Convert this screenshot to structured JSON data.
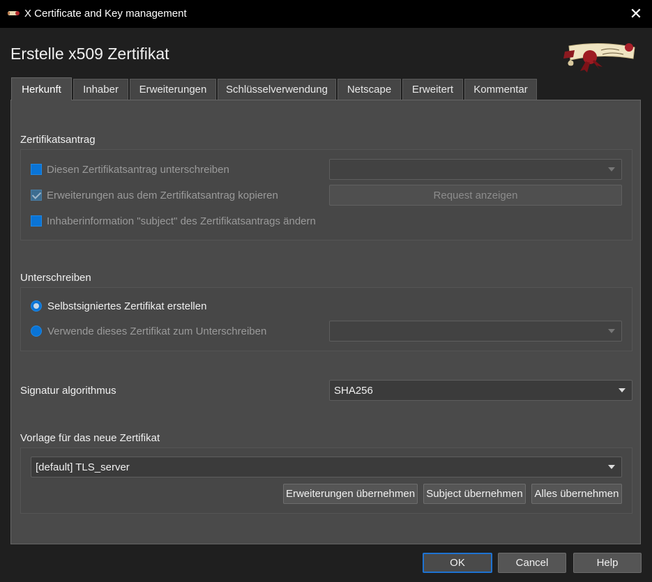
{
  "window": {
    "title": "X Certificate and Key management",
    "close_glyph": "✕"
  },
  "dialog": {
    "heading": "Erstelle x509 Zertifikat"
  },
  "tabs": [
    {
      "label": "Herkunft",
      "active": true
    },
    {
      "label": "Inhaber",
      "active": false
    },
    {
      "label": "Erweiterungen",
      "active": false
    },
    {
      "label": "Schlüsselverwendung",
      "active": false
    },
    {
      "label": "Netscape",
      "active": false
    },
    {
      "label": "Erweitert",
      "active": false
    },
    {
      "label": "Kommentar",
      "active": false
    }
  ],
  "request_section": {
    "label": "Zertifikatsantrag",
    "sign_request": {
      "label": "Diesen Zertifikatsantrag unterschreiben",
      "checked": false,
      "enabled": false
    },
    "copy_extensions": {
      "label": "Erweiterungen aus dem Zertifikatsantrag kopieren",
      "checked": true,
      "enabled": false
    },
    "modify_subject": {
      "label": "Inhaberinformation \"subject\" des Zertifikatsantrags ändern",
      "checked": false,
      "enabled": false
    },
    "request_combo_value": "",
    "show_request_button": "Request anzeigen"
  },
  "signing_section": {
    "label": "Unterschreiben",
    "self_signed": {
      "label": "Selbstsigniertes Zertifikat erstellen",
      "selected": true
    },
    "use_ca": {
      "label": "Verwende dieses Zertifikat zum Unterschreiben",
      "selected": false
    },
    "ca_combo_value": ""
  },
  "signature": {
    "label": "Signatur algorithmus",
    "value": "SHA256"
  },
  "template_section": {
    "label": "Vorlage für das neue Zertifikat",
    "value": "[default] TLS_server",
    "apply_extensions_button": "Erweiterungen übernehmen",
    "apply_subject_button": "Subject übernehmen",
    "apply_all_button": "Alles übernehmen"
  },
  "footer": {
    "ok_button": "OK",
    "cancel_button": "Cancel",
    "help_button": "Help"
  },
  "colors": {
    "accent": "#1e73d2",
    "checkbox_blue": "#0a74d6",
    "title_bar": "#000000",
    "panel": "#4a4a4a"
  },
  "icons": {
    "app": "certificate-scroll-icon",
    "close": "close-icon",
    "logo": "scroll-seal-logo"
  }
}
